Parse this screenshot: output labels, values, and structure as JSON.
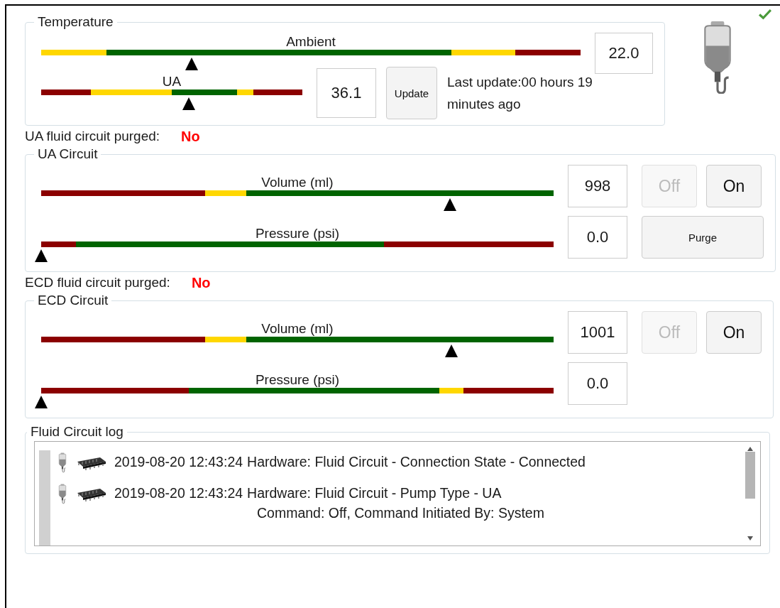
{
  "temperature": {
    "title": "Temperature",
    "ambient": {
      "label": "Ambient",
      "value": "22.0",
      "segments": [
        {
          "color": "#ffd700"
        },
        {
          "color": "#006400"
        },
        {
          "color": "#ffd700"
        },
        {
          "color": "#8b0000"
        }
      ]
    },
    "ua": {
      "label": "UA",
      "value": "36.1",
      "segments": [
        {
          "color": "#8b0000"
        },
        {
          "color": "#ffd700"
        },
        {
          "color": "#006400"
        },
        {
          "color": "#ffd700"
        },
        {
          "color": "#8b0000"
        }
      ]
    },
    "update_button": "Update",
    "last_update": "Last update:00 hours 19 minutes ago"
  },
  "status_ok": true,
  "circuits": [
    {
      "purged_label": "UA fluid circuit purged:",
      "purged_value": "No",
      "title": "UA Circuit",
      "rows": [
        {
          "kind": "volume",
          "label": "Volume (ml)",
          "value": "998",
          "segments": [
            {
              "color": "#8b0000"
            },
            {
              "color": "#ffd700"
            },
            {
              "color": "#006400"
            }
          ],
          "buttons": [
            {
              "label": "Off",
              "disabled": true
            },
            {
              "label": "On",
              "disabled": false
            }
          ]
        },
        {
          "kind": "pressure",
          "label": "Pressure (psi)",
          "value": "0.0",
          "segments": [
            {
              "color": "#8b0000"
            },
            {
              "color": "#006400"
            },
            {
              "color": "#8b0000"
            }
          ],
          "buttons": [
            {
              "label": "Purge",
              "disabled": false
            }
          ]
        }
      ]
    },
    {
      "purged_label": "ECD fluid circuit purged:",
      "purged_value": "No",
      "title": "ECD Circuit",
      "rows": [
        {
          "kind": "volume",
          "label": "Volume (ml)",
          "value": "1001",
          "segments": [
            {
              "color": "#8b0000"
            },
            {
              "color": "#ffd700"
            },
            {
              "color": "#006400"
            }
          ],
          "buttons": [
            {
              "label": "Off",
              "disabled": true
            },
            {
              "label": "On",
              "disabled": false
            }
          ]
        },
        {
          "kind": "pressure",
          "label": "Pressure (psi)",
          "value": "0.0",
          "segments": [
            {
              "color": "#8b0000"
            },
            {
              "color": "#006400"
            },
            {
              "color": "#ffd700"
            },
            {
              "color": "#8b0000"
            }
          ]
        }
      ]
    }
  ],
  "log": {
    "title": "Fluid Circuit log",
    "entries": [
      {
        "time": "2019-08-20 12:43:24",
        "message": "Hardware: Fluid Circuit - Connection State - Connected"
      },
      {
        "time": "2019-08-20 12:43:24",
        "message": "Hardware: Fluid Circuit - Pump Type - UA",
        "detail": "Command: Off, Command Initiated By: System"
      }
    ]
  }
}
